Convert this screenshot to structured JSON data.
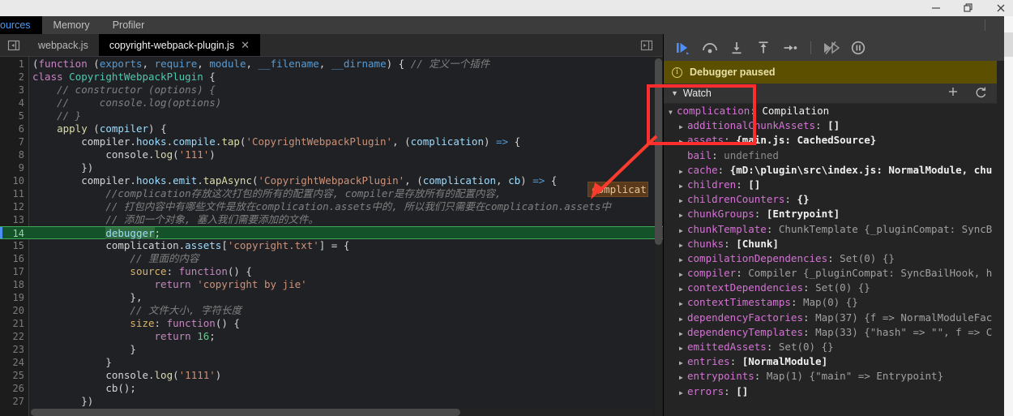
{
  "window": {
    "controls": [
      {
        "name": "minimize-button",
        "glyph": "minimize"
      },
      {
        "name": "maximize-button",
        "glyph": "restore"
      },
      {
        "name": "close-button",
        "glyph": "close"
      }
    ]
  },
  "devtools_tabs": {
    "items": [
      {
        "label": "ources",
        "active": true,
        "clipped": true
      },
      {
        "label": "Memory",
        "active": false
      },
      {
        "label": "Profiler",
        "active": false
      }
    ],
    "more_options_icon": "kebab-menu-icon"
  },
  "editor": {
    "navigator_toggle_icon": "show-navigator-icon",
    "right_panel_icon": "show-debugger-icon",
    "tabs": [
      {
        "label": "webpack.js",
        "active": false,
        "closable": false
      },
      {
        "label": "copyright-webpack-plugin.js",
        "active": true,
        "closable": true,
        "close_label": "✕"
      }
    ],
    "highlighted_line": 14,
    "hover_tooltip": "complicati",
    "code": [
      {
        "n": 1,
        "html": "<span class='t-pl'>(</span><span class='t-kw'>function</span> <span class='t-pl'>(</span><span class='t-kw2'>exports</span><span class='t-pl'>, </span><span class='t-kw2'>require</span><span class='t-pl'>, </span><span class='t-kw2'>module</span><span class='t-pl'>, </span><span class='t-kw2'>__filename</span><span class='t-pl'>, </span><span class='t-kw2'>__dirname</span><span class='t-pl'>) { </span><span class='t-cmt'>// 定义一个插件</span>"
      },
      {
        "n": 2,
        "html": "<span class='t-kw'>class</span> <span class='t-cls'>CopyrightWebpackPlugin</span> <span class='t-pl'>{</span>"
      },
      {
        "n": 3,
        "html": "    <span class='t-cmt'>// constructor (options) {</span>"
      },
      {
        "n": 4,
        "html": "    <span class='t-cmt'>//     console.log(options)</span>"
      },
      {
        "n": 5,
        "html": "    <span class='t-cmt'>// }</span>"
      },
      {
        "n": 6,
        "html": "    <span class='t-fn'>apply</span> <span class='t-pl'>(</span><span class='t-var'>compiler</span><span class='t-pl'>) {</span>"
      },
      {
        "n": 7,
        "html": "        <span class='t-pl'>compiler.</span><span class='t-var'>hooks</span><span class='t-pl'>.</span><span class='t-var'>compile</span><span class='t-pl'>.</span><span class='t-fn'>tap</span><span class='t-pl'>(</span><span class='t-str'>'CopyrightWebpackPlugin'</span><span class='t-pl'>, (</span><span class='t-var'>complication</span><span class='t-pl'>) </span><span class='t-arrow'>=&gt;</span><span class='t-pl'> {</span>"
      },
      {
        "n": 8,
        "html": "            <span class='t-pl'>console.</span><span class='t-fn'>log</span><span class='t-pl'>(</span><span class='t-str'>'111'</span><span class='t-pl'>)</span>"
      },
      {
        "n": 9,
        "html": "        <span class='t-pl'>})</span>"
      },
      {
        "n": 10,
        "html": "        <span class='t-pl'>compiler.</span><span class='t-var'>hooks</span><span class='t-pl'>.</span><span class='t-var'>emit</span><span class='t-pl'>.</span><span class='t-fn'>tapAsync</span><span class='t-pl'>(</span><span class='t-str'>'CopyrightWebpackPlugin'</span><span class='t-pl'>, (</span><span class='t-var'>complication</span><span class='t-pl'>, </span><span class='t-var'>cb</span><span class='t-pl'>) </span><span class='t-arrow'>=&gt;</span><span class='t-pl'> {</span>"
      },
      {
        "n": 11,
        "html": "            <span class='t-cmt'>//complication存放这次打包的所有的配置内容, compiler是存放所有的配置内容,</span>"
      },
      {
        "n": 12,
        "html": "            <span class='t-cmt'>// 打包内容中有哪些文件是放在complication.assets中的, 所以我们只需要在complication.assets中</span>"
      },
      {
        "n": 13,
        "html": "            <span class='t-cmt'>// 添加一个对象, 塞入我们需要添加的文件。</span>"
      },
      {
        "n": 14,
        "html": "            <span class='sel t-var'>debugger</span><span class='t-pl'>;</span>"
      },
      {
        "n": 15,
        "html": "            <span class='t-pl'>complication.</span><span class='t-var'>assets</span><span class='t-pl'>[</span><span class='t-str'>'copyright.txt'</span><span class='t-pl'>] = {</span>"
      },
      {
        "n": 16,
        "html": "                <span class='t-cmt'>// 里面的内容</span>"
      },
      {
        "n": 17,
        "html": "                <span class='t-prop'>source</span><span class='t-pl'>: </span><span class='t-kw'>function</span><span class='t-pl'>() {</span>"
      },
      {
        "n": 18,
        "html": "                    <span class='t-kw'>return</span> <span class='t-str'>'copyright by jie'</span>"
      },
      {
        "n": 19,
        "html": "                <span class='t-pl'>},</span>"
      },
      {
        "n": 20,
        "html": "                <span class='t-cmt'>// 文件大小, 字符长度</span>"
      },
      {
        "n": 21,
        "html": "                <span class='t-prop'>size</span><span class='t-pl'>: </span><span class='t-kw'>function</span><span class='t-pl'>() {</span>"
      },
      {
        "n": 22,
        "html": "                    <span class='t-kw'>return</span> <span class='t-num'>16</span><span class='t-pl'>;</span>"
      },
      {
        "n": 23,
        "html": "                <span class='t-pl'>}</span>"
      },
      {
        "n": 24,
        "html": "            <span class='t-pl'>}</span>"
      },
      {
        "n": 25,
        "html": "            <span class='t-pl'>console.</span><span class='t-fn'>log</span><span class='t-pl'>(</span><span class='t-str'>'1111'</span><span class='t-pl'>)</span>"
      },
      {
        "n": 26,
        "html": "            <span class='t-pl'>cb();</span>"
      },
      {
        "n": 27,
        "html": "        <span class='t-pl'>})</span>"
      }
    ]
  },
  "debugger": {
    "toolbar": [
      {
        "name": "resume-script-execution-button",
        "icon": "resume-icon"
      },
      {
        "name": "step-over-next-function-call-button",
        "icon": "step-over-icon"
      },
      {
        "name": "step-into-next-function-call-button",
        "icon": "step-into-icon"
      },
      {
        "name": "step-out-of-current-function-button",
        "icon": "step-out-icon"
      },
      {
        "name": "step-button",
        "icon": "step-icon"
      },
      {
        "name": "deactivate-breakpoints-button",
        "icon": "deactivate-breakpoints-icon"
      },
      {
        "name": "pause-on-exceptions-button",
        "icon": "pause-on-exceptions-icon"
      }
    ],
    "paused_banner": {
      "text": "Debugger paused",
      "icon": "info-icon",
      "bg_color": "#5c5000"
    },
    "watch": {
      "title": "Watch",
      "expanded": true,
      "add_icon": "plus-icon",
      "refresh_icon": "refresh-icon",
      "rows": [
        {
          "indent": 0,
          "caret": "open",
          "name": "complication",
          "sep": ": ",
          "value": "Compilation",
          "value_class": "wval-cls"
        },
        {
          "indent": 1,
          "caret": "closed",
          "name": "additionalChunkAssets",
          "sep": ": ",
          "value": "[]",
          "value_class": "wval-b"
        },
        {
          "indent": 1,
          "caret": "closed",
          "name": "assets",
          "sep": ": ",
          "value": "{main.js: CachedSource}",
          "value_class": "wval-b"
        },
        {
          "indent": 1,
          "caret": "none",
          "name": "bail",
          "sep": ": ",
          "value": "undefined",
          "value_class": "wval-undef"
        },
        {
          "indent": 1,
          "caret": "closed",
          "name": "cache",
          "sep": ": ",
          "value": "{mD:\\plugin\\src\\index.js: NormalModule, chu",
          "value_class": "wval-b"
        },
        {
          "indent": 1,
          "caret": "closed",
          "name": "children",
          "sep": ": ",
          "value": "[]",
          "value_class": "wval-b"
        },
        {
          "indent": 1,
          "caret": "closed",
          "name": "childrenCounters",
          "sep": ": ",
          "value": "{}",
          "value_class": "wval-b"
        },
        {
          "indent": 1,
          "caret": "closed",
          "name": "chunkGroups",
          "sep": ": ",
          "value": "[Entrypoint]",
          "value_class": "wval-b"
        },
        {
          "indent": 1,
          "caret": "closed",
          "name": "chunkTemplate",
          "sep": ": ",
          "value": "ChunkTemplate {_pluginCompat: SyncB",
          "value_class": "wval-dim"
        },
        {
          "indent": 1,
          "caret": "closed",
          "name": "chunks",
          "sep": ": ",
          "value": "[Chunk]",
          "value_class": "wval-b"
        },
        {
          "indent": 1,
          "caret": "closed",
          "name": "compilationDependencies",
          "sep": ": ",
          "value": "Set(0) {}",
          "value_class": "wval-dim"
        },
        {
          "indent": 1,
          "caret": "closed",
          "name": "compiler",
          "sep": ": ",
          "value": "Compiler {_pluginCompat: SyncBailHook, h",
          "value_class": "wval-dim"
        },
        {
          "indent": 1,
          "caret": "closed",
          "name": "contextDependencies",
          "sep": ": ",
          "value": "Set(0) {}",
          "value_class": "wval-dim"
        },
        {
          "indent": 1,
          "caret": "closed",
          "name": "contextTimestamps",
          "sep": ": ",
          "value": "Map(0) {}",
          "value_class": "wval-dim"
        },
        {
          "indent": 1,
          "caret": "closed",
          "name": "dependencyFactories",
          "sep": ": ",
          "value": "Map(37) {f => NormalModuleFac",
          "value_class": "wval-dim"
        },
        {
          "indent": 1,
          "caret": "closed",
          "name": "dependencyTemplates",
          "sep": ": ",
          "value": "Map(33) {\"hash\" => \"\", f => C",
          "value_class": "wval-dim"
        },
        {
          "indent": 1,
          "caret": "closed",
          "name": "emittedAssets",
          "sep": ": ",
          "value": "Set(0) {}",
          "value_class": "wval-dim"
        },
        {
          "indent": 1,
          "caret": "closed",
          "name": "entries",
          "sep": ": ",
          "value": "[NormalModule]",
          "value_class": "wval-b"
        },
        {
          "indent": 1,
          "caret": "closed",
          "name": "entrypoints",
          "sep": ": ",
          "value": "Map(1) {\"main\" => Entrypoint}",
          "value_class": "wval-dim"
        },
        {
          "indent": 1,
          "caret": "closed",
          "name": "errors",
          "sep": ": ",
          "value": "[]",
          "value_class": "wval-b"
        }
      ]
    }
  },
  "annotations": {
    "box_target": "watch-section-header",
    "arrow_target": "hover-tooltip",
    "color": "#ff2d2d"
  }
}
